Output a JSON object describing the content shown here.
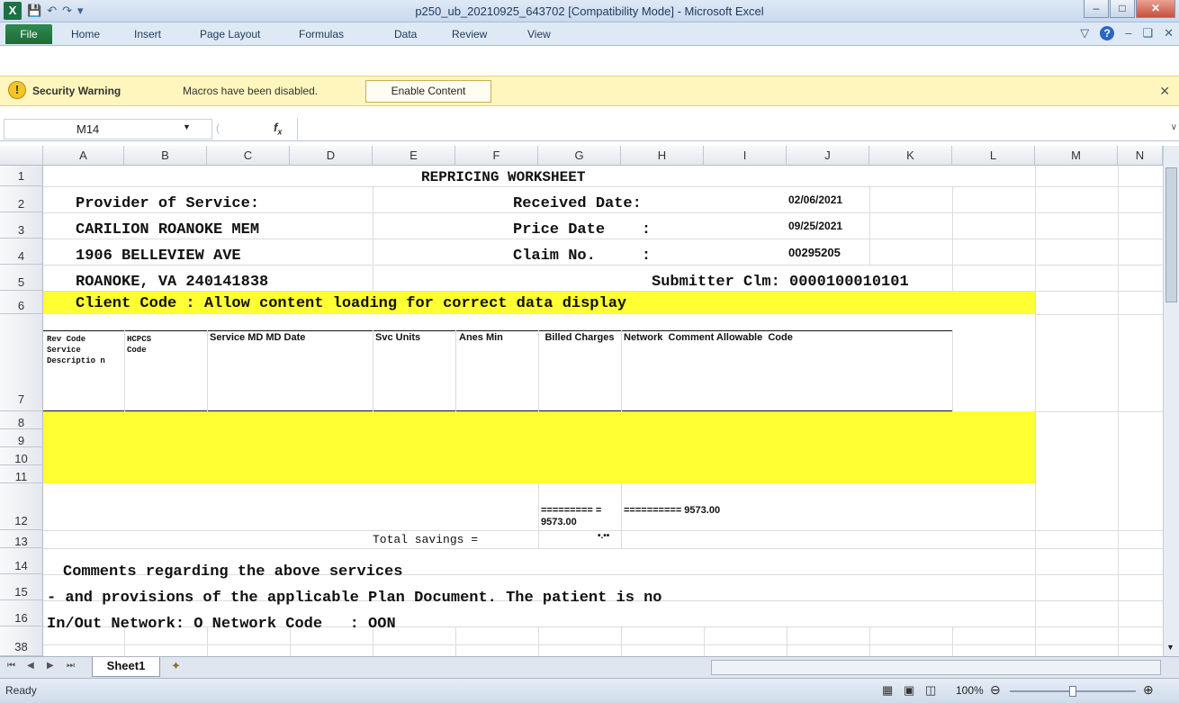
{
  "window": {
    "title": "p250_ub_20210925_643702  [Compatibility Mode]  -  Microsoft Excel",
    "logo": "X"
  },
  "menu": [
    "File",
    "Home",
    "Insert",
    "Page Layout",
    "Formulas",
    "Data",
    "Review",
    "View"
  ],
  "security": {
    "title": "Security Warning",
    "message": "Macros have been disabled.",
    "button": "Enable Content"
  },
  "formula_bar": {
    "cell_ref": "M14",
    "fx": "fx",
    "content": ""
  },
  "columns": [
    "A",
    "B",
    "C",
    "D",
    "E",
    "F",
    "G",
    "H",
    "I",
    "J",
    "K",
    "L",
    "M",
    "N"
  ],
  "rows": [
    "1",
    "2",
    "3",
    "4",
    "5",
    "6",
    "7",
    "8",
    "9",
    "10",
    "11",
    "12",
    "13",
    "14",
    "15",
    "16",
    "38"
  ],
  "sheet": {
    "title": "REPRICING WORKSHEET",
    "provider_label": "Provider of Service:",
    "received_label": "Received Date:",
    "received_value": "02/06/2021",
    "provider_name": "CARILION ROANOKE MEM",
    "price_label": "Price Date    :",
    "price_value": "09/25/2021",
    "address": "1906 BELLEVIEW AVE",
    "claim_label": "Claim No.     :",
    "claim_value": "00295205",
    "city": "ROANOKE, VA 240141838",
    "submitter": "Submitter Clm: 0000100010101",
    "client_code": "Client Code : Allow content loading for correct data display",
    "hdr_rev": "Rev Code Service Descriptio n",
    "hdr_hcpcs": "HCPCS Code",
    "hdr_service": "Service MD MD Date",
    "hdr_units": "Svc Units",
    "hdr_anes": "Anes Min",
    "hdr_billed": "Billed Charges",
    "hdr_network": "Network  Comment Allowable  Code",
    "g12": "========= = 9573.00",
    "h12": "========== 9573.00",
    "total_savings": "Total savings =",
    "g13": "•.••",
    "comments": "Comments regarding the above services",
    "provisions": "- and provisions of the applicable Plan Document. The patient is no",
    "network": "In/Out Network: O Network Code   : OON"
  },
  "sheet_tab": "Sheet1",
  "status": {
    "ready": "Ready",
    "zoom": "100%"
  }
}
